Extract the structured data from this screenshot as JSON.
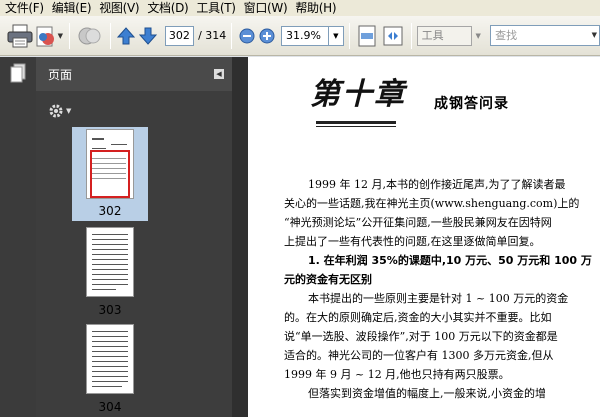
{
  "menubar": {
    "items": [
      "文件(F)",
      "编辑(E)",
      "视图(V)",
      "文档(D)",
      "工具(T)",
      "窗口(W)",
      "帮助(H)"
    ]
  },
  "toolbar": {
    "current_page": "302",
    "total_pages": "/ 314",
    "zoom": "31.9%",
    "tools_label": "工具",
    "search_placeholder": "查找"
  },
  "panel": {
    "title": "页面",
    "thumbnails": [
      {
        "label": "302",
        "selected": true
      },
      {
        "label": "303",
        "selected": false
      },
      {
        "label": "304",
        "selected": false
      }
    ]
  },
  "document": {
    "chapter": "第十章",
    "title": "成钢答问录",
    "paragraphs": [
      {
        "lines": [
          "1999 年 12 月,本书的创作接近尾声,为了了解读者最",
          "关心的一些话题,我在神光主页(www.shenguang.com)上的",
          "“神光预测论坛”公开征集问题,一些股民兼网友在因特网",
          "上提出了一些有代表性的问题,在这里逐做简单回复。"
        ]
      },
      {
        "lines": [
          "1. 在年利润 35%的课题中,10 万元、50 万元和 100 万",
          "元的资金有无区别"
        ]
      },
      {
        "lines": [
          "本书提出的一些原则主要是针对 1 ~ 100 万元的资金",
          "的。在大的原则确定后,资金的大小其实并不重要。比如",
          "说“单一选股、波段操作”,对于 100 万元以下的资金都是",
          "适合的。神光公司的一位客户有 1300 多万元资金,但从",
          "1999 年 9 月 ~ 12 月,他也只持有两只股票。"
        ]
      },
      {
        "lines": [
          "但落实到资金增值的幅度上,一般来说,小资金的增"
        ]
      }
    ]
  }
}
